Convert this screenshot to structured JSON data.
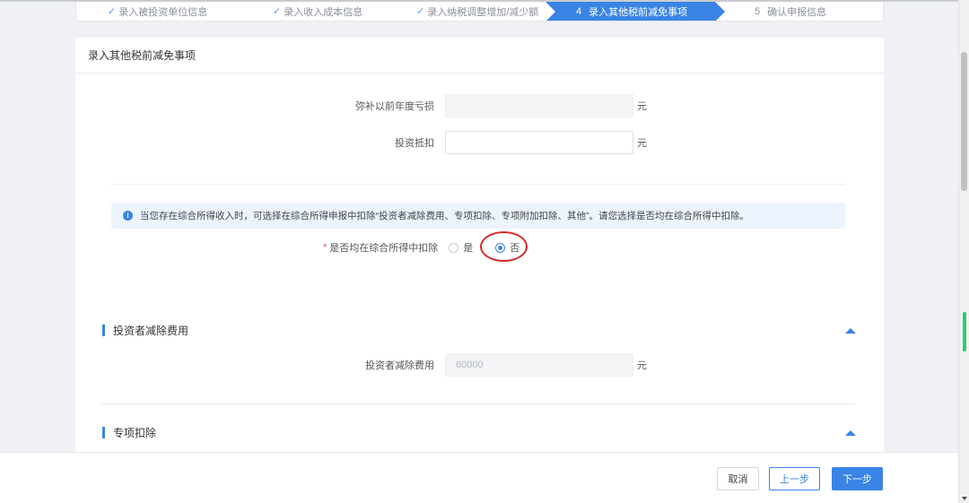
{
  "steps": [
    {
      "label": "录入被投资单位信息",
      "status": "done",
      "check": "✓"
    },
    {
      "label": "录入收入成本信息",
      "status": "done",
      "check": "✓"
    },
    {
      "label": "录入纳税调整增加/减少额",
      "status": "done",
      "check": "✓"
    },
    {
      "num": "4",
      "label": "录入其他税前减免事项",
      "status": "active"
    },
    {
      "num": "5",
      "label": "确认申报信息",
      "status": "pending"
    }
  ],
  "card": {
    "title": "录入其他税前减免事项"
  },
  "fields": {
    "loss_offset": {
      "label": "弥补以前年度亏损",
      "value": "",
      "unit": "元"
    },
    "investment_deduction": {
      "label": "投资抵扣",
      "value": "",
      "unit": "元"
    }
  },
  "notice": {
    "icon": "info-icon",
    "text": "当您存在综合所得收入时，可选择在综合所得申报中扣除“投资者减除费用、专项扣除、专项附加扣除、其他”。请您选择是否均在综合所得中扣除。"
  },
  "deduct_choice": {
    "required_mark": "*",
    "label": "是否均在综合所得中扣除",
    "options": [
      {
        "label": "是",
        "selected": false
      },
      {
        "label": "否",
        "selected": true
      }
    ]
  },
  "sections": {
    "investor_deduction": {
      "title": "投资者减除费用",
      "field_label": "投资者减除费用",
      "value": "60000",
      "unit": "元"
    },
    "special_deduction": {
      "title": "专项扣除"
    }
  },
  "footer": {
    "cancel": "取消",
    "prev": "上一步",
    "next": "下一步"
  },
  "colors": {
    "accent": "#3a84e6",
    "highlight": "#d62b2b"
  }
}
